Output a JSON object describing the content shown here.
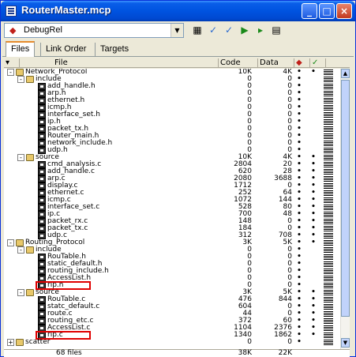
{
  "window": {
    "title": "RouterMaster.mcp"
  },
  "toolbar": {
    "target": "DebugRel"
  },
  "tabs": [
    {
      "label": "Files"
    },
    {
      "label": "Link Order"
    },
    {
      "label": "Targets"
    }
  ],
  "columns": {
    "file": "File",
    "code": "Code",
    "data": "Data"
  },
  "rows": [
    {
      "indent": 0,
      "type": "folder",
      "toggle": "-",
      "name": "Network_Protocol",
      "code": "10K",
      "data": "4K",
      "dbg": "•",
      "chk": "•"
    },
    {
      "indent": 1,
      "type": "folder",
      "toggle": "-",
      "name": "include",
      "code": "0",
      "data": "0",
      "dbg": "•",
      "chk": ""
    },
    {
      "indent": 2,
      "type": "file",
      "toggle": "",
      "name": "add_handle.h",
      "code": "0",
      "data": "0",
      "dbg": "•",
      "chk": ""
    },
    {
      "indent": 2,
      "type": "file",
      "toggle": "",
      "name": "arp.h",
      "code": "0",
      "data": "0",
      "dbg": "•",
      "chk": ""
    },
    {
      "indent": 2,
      "type": "file",
      "toggle": "",
      "name": "ethernet.h",
      "code": "0",
      "data": "0",
      "dbg": "•",
      "chk": ""
    },
    {
      "indent": 2,
      "type": "file",
      "toggle": "",
      "name": "icmp.h",
      "code": "0",
      "data": "0",
      "dbg": "•",
      "chk": ""
    },
    {
      "indent": 2,
      "type": "file",
      "toggle": "",
      "name": "interface_set.h",
      "code": "0",
      "data": "0",
      "dbg": "•",
      "chk": ""
    },
    {
      "indent": 2,
      "type": "file",
      "toggle": "",
      "name": "ip.h",
      "code": "0",
      "data": "0",
      "dbg": "•",
      "chk": ""
    },
    {
      "indent": 2,
      "type": "file",
      "toggle": "",
      "name": "packet_tx.h",
      "code": "0",
      "data": "0",
      "dbg": "•",
      "chk": ""
    },
    {
      "indent": 2,
      "type": "file",
      "toggle": "",
      "name": "Router_main.h",
      "code": "0",
      "data": "0",
      "dbg": "•",
      "chk": ""
    },
    {
      "indent": 2,
      "type": "file",
      "toggle": "",
      "name": "network_include.h",
      "code": "0",
      "data": "0",
      "dbg": "•",
      "chk": ""
    },
    {
      "indent": 2,
      "type": "file",
      "toggle": "",
      "name": "udp.h",
      "code": "0",
      "data": "0",
      "dbg": "•",
      "chk": ""
    },
    {
      "indent": 1,
      "type": "folder",
      "toggle": "-",
      "name": "source",
      "code": "10K",
      "data": "4K",
      "dbg": "•",
      "chk": "•"
    },
    {
      "indent": 2,
      "type": "file",
      "toggle": "",
      "name": "cmd_analysis.c",
      "code": "2804",
      "data": "20",
      "dbg": "•",
      "chk": "•"
    },
    {
      "indent": 2,
      "type": "file",
      "toggle": "",
      "name": "add_handle.c",
      "code": "620",
      "data": "28",
      "dbg": "•",
      "chk": "•"
    },
    {
      "indent": 2,
      "type": "file",
      "toggle": "",
      "name": "arp.c",
      "code": "2080",
      "data": "3688",
      "dbg": "•",
      "chk": "•"
    },
    {
      "indent": 2,
      "type": "file",
      "toggle": "",
      "name": "display.c",
      "code": "1712",
      "data": "0",
      "dbg": "•",
      "chk": "•"
    },
    {
      "indent": 2,
      "type": "file",
      "toggle": "",
      "name": "ethernet.c",
      "code": "252",
      "data": "64",
      "dbg": "•",
      "chk": "•"
    },
    {
      "indent": 2,
      "type": "file",
      "toggle": "",
      "name": "icmp.c",
      "code": "1072",
      "data": "144",
      "dbg": "•",
      "chk": "•"
    },
    {
      "indent": 2,
      "type": "file",
      "toggle": "",
      "name": "interface_set.c",
      "code": "528",
      "data": "80",
      "dbg": "•",
      "chk": "•"
    },
    {
      "indent": 2,
      "type": "file",
      "toggle": "",
      "name": "ip.c",
      "code": "700",
      "data": "48",
      "dbg": "•",
      "chk": "•"
    },
    {
      "indent": 2,
      "type": "file",
      "toggle": "",
      "name": "packet_rx.c",
      "code": "148",
      "data": "0",
      "dbg": "•",
      "chk": "•"
    },
    {
      "indent": 2,
      "type": "file",
      "toggle": "",
      "name": "packet_tx.c",
      "code": "184",
      "data": "0",
      "dbg": "•",
      "chk": "•"
    },
    {
      "indent": 2,
      "type": "file",
      "toggle": "",
      "name": "udp.c",
      "code": "312",
      "data": "708",
      "dbg": "•",
      "chk": "•"
    },
    {
      "indent": 0,
      "type": "folder",
      "toggle": "-",
      "name": "Routing_Protocol",
      "code": "3K",
      "data": "5K",
      "dbg": "•",
      "chk": "•"
    },
    {
      "indent": 1,
      "type": "folder",
      "toggle": "-",
      "name": "include",
      "code": "0",
      "data": "0",
      "dbg": "•",
      "chk": ""
    },
    {
      "indent": 2,
      "type": "file",
      "toggle": "",
      "name": "RouTable.h",
      "code": "0",
      "data": "0",
      "dbg": "•",
      "chk": ""
    },
    {
      "indent": 2,
      "type": "file",
      "toggle": "",
      "name": "static_default.h",
      "code": "0",
      "data": "0",
      "dbg": "•",
      "chk": ""
    },
    {
      "indent": 2,
      "type": "file",
      "toggle": "",
      "name": "routing_include.h",
      "code": "0",
      "data": "0",
      "dbg": "•",
      "chk": ""
    },
    {
      "indent": 2,
      "type": "file",
      "toggle": "",
      "name": "AccessList.h",
      "code": "0",
      "data": "0",
      "dbg": "•",
      "chk": ""
    },
    {
      "indent": 2,
      "type": "file",
      "toggle": "",
      "name": "rip.h",
      "code": "0",
      "data": "0",
      "dbg": "•",
      "chk": "",
      "highlight": true
    },
    {
      "indent": 1,
      "type": "folder",
      "toggle": "-",
      "name": "source",
      "code": "3K",
      "data": "5K",
      "dbg": "•",
      "chk": "•"
    },
    {
      "indent": 2,
      "type": "file",
      "toggle": "",
      "name": "RouTable.c",
      "code": "476",
      "data": "844",
      "dbg": "•",
      "chk": "•"
    },
    {
      "indent": 2,
      "type": "file",
      "toggle": "",
      "name": "statc_default.c",
      "code": "604",
      "data": "0",
      "dbg": "•",
      "chk": "•"
    },
    {
      "indent": 2,
      "type": "file",
      "toggle": "",
      "name": "route.c",
      "code": "44",
      "data": "0",
      "dbg": "•",
      "chk": "•"
    },
    {
      "indent": 2,
      "type": "file",
      "toggle": "",
      "name": "routing_etc.c",
      "code": "372",
      "data": "60",
      "dbg": "•",
      "chk": "•"
    },
    {
      "indent": 2,
      "type": "file",
      "toggle": "",
      "name": "AccessList.c",
      "code": "1104",
      "data": "2376",
      "dbg": "•",
      "chk": "•"
    },
    {
      "indent": 2,
      "type": "file",
      "toggle": "",
      "name": "rip.c",
      "code": "1340",
      "data": "1862",
      "dbg": "•",
      "chk": "•",
      "highlight": true
    },
    {
      "indent": 0,
      "type": "folder",
      "toggle": "+",
      "name": "scatter",
      "code": "0",
      "data": "0",
      "dbg": "•",
      "chk": ""
    }
  ],
  "footer": {
    "files": "68 files",
    "code": "38K",
    "data": "22K"
  }
}
